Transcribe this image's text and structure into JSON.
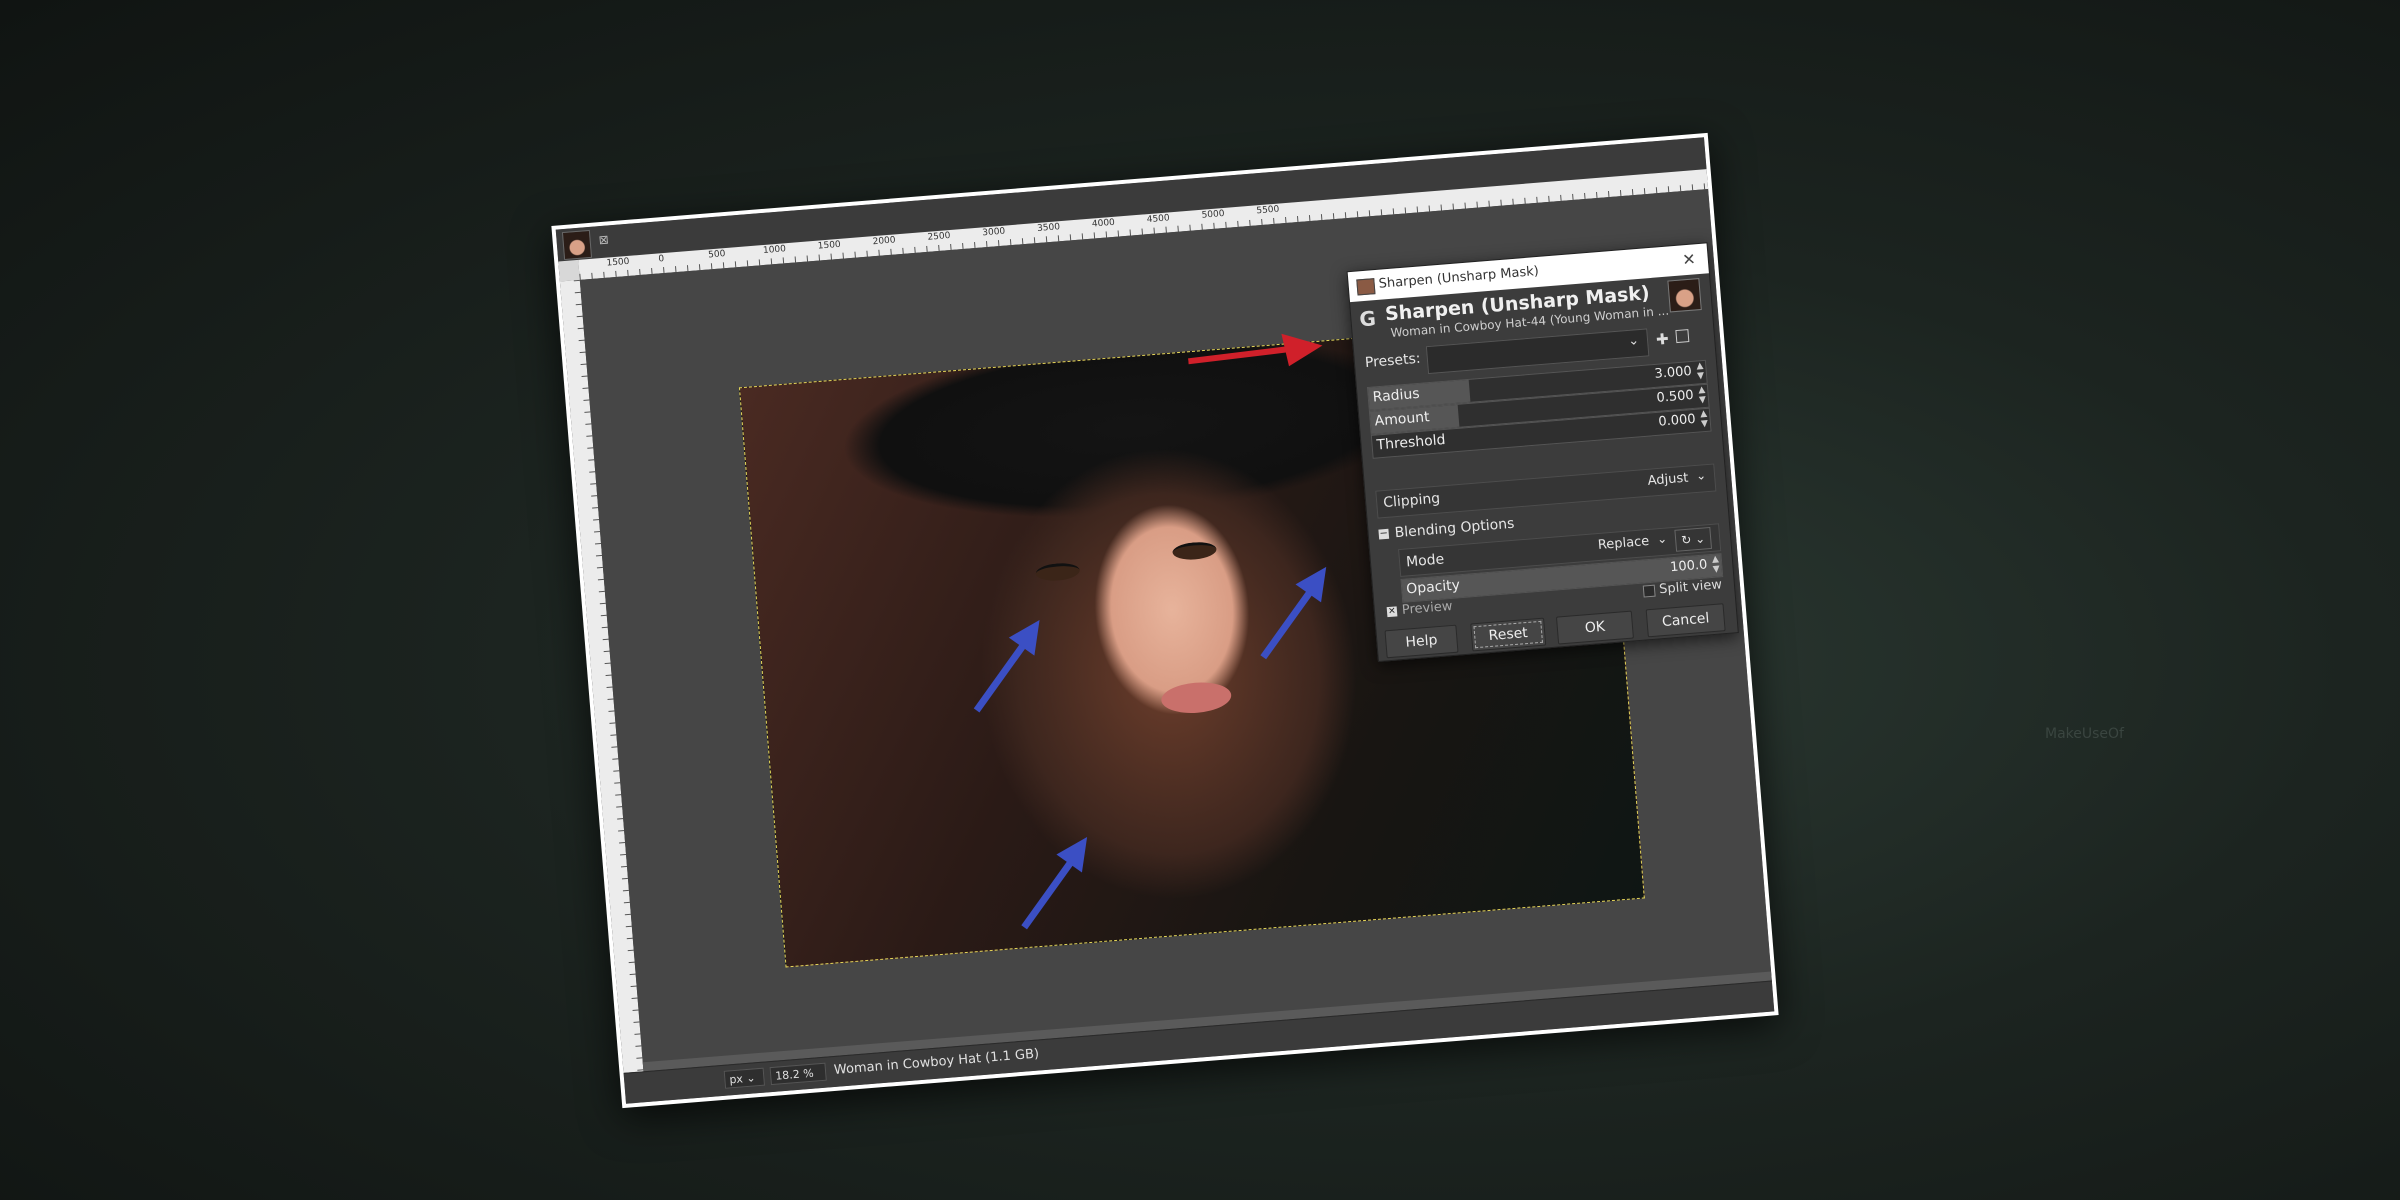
{
  "watermark": "MakeUseOf",
  "window": {
    "tab": {
      "close_icon": "close-icon"
    },
    "ruler_labels": [
      "1500",
      "0",
      "500",
      "1000",
      "1500",
      "2000",
      "2500",
      "3000",
      "3500",
      "4000",
      "4500",
      "5000",
      "5500"
    ],
    "status": {
      "unit": "px",
      "zoom": "18.2 %",
      "title": "Woman in Cowboy Hat (1.1 GB)"
    }
  },
  "dialog": {
    "window_title": "Sharpen (Unsharp Mask)",
    "heading": "Sharpen (Unsharp Mask)",
    "subheading": "Woman in Cowboy Hat-44 (Young Woman in ...",
    "presets_label": "Presets:",
    "presets_value": "",
    "radius": {
      "label": "Radius",
      "value": "3.000",
      "fraction": 0.3
    },
    "amount": {
      "label": "Amount",
      "value": "0.500",
      "fraction": 0.26
    },
    "threshold": {
      "label": "Threshold",
      "value": "0.000",
      "fraction": 0.0
    },
    "clipping": {
      "label": "Clipping",
      "value": "Adjust"
    },
    "blending_options": "Blending Options",
    "mode": {
      "label": "Mode",
      "value": "Replace"
    },
    "opacity": {
      "label": "Opacity",
      "value": "100.0",
      "fraction": 1.0
    },
    "split_view": "Split view",
    "preview": "Preview",
    "buttons": {
      "help": "Help",
      "reset": "Reset",
      "ok": "OK",
      "cancel": "Cancel"
    }
  },
  "colors": {
    "annotation_red": "#d0202a",
    "annotation_blue": "#3b4fc4",
    "selection_border": "#e4d65a"
  }
}
